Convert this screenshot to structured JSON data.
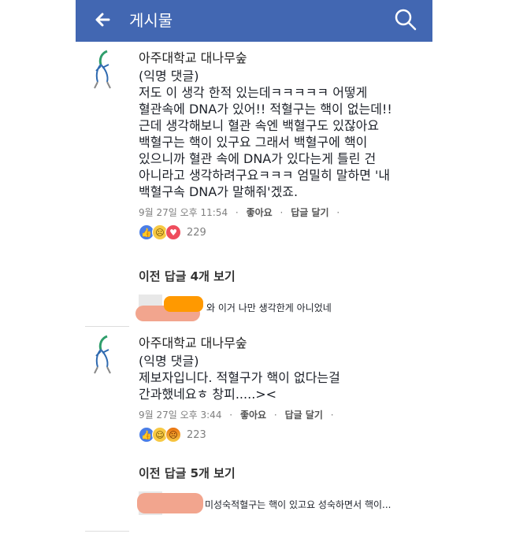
{
  "header": {
    "title": "게시물",
    "back_icon": "back-arrow-icon",
    "search_icon": "search-icon"
  },
  "comments": [
    {
      "author": "아주대학교 대나무숲",
      "lines": [
        "(익명 댓글)",
        "저도 이 생각 한적 있는데ㅋㅋㅋㅋㅋ 어떻게",
        "혈관속에  DNA가 있어!! 적혈구는 핵이 없는데!!",
        "근데 생각해보니 혈관 속엔 백혈구도 있잖아요",
        "백혈구는 핵이 있구요 그래서 백혈구에 핵이",
        "있으니까 혈관 속에 DNA가 있다는게 틀린 건",
        "아니라고 생각하려구요ㅋㅋㅋ 엄밀히 말하면 '내",
        "백혈구속 DNA가 말해줘'겠죠."
      ],
      "time": "9월 27일 오후 11:54",
      "like": "좋아요",
      "reply": "답글 달기",
      "reaction_count": "229"
    },
    {
      "author": "아주대학교 대나무숲",
      "lines": [
        "(익명 댓글)",
        "제보자입니다. 적혈구가 핵이 없다는걸",
        "간과했네요ㅎ 창피.....><"
      ],
      "time": "9월 27일 오후 3:44",
      "like": "좋아요",
      "reply": "답글 달기",
      "reaction_count": "223"
    }
  ],
  "replies": [
    {
      "prev_label": "이전 답글 4개 보기",
      "text": "와 이거 나만 생각한게 아니었네"
    },
    {
      "prev_label": "이전 답글 5개 보기",
      "text": "미성숙적혈구는 핵이 있고요 성숙하면서 핵이..."
    }
  ],
  "dot": "·"
}
